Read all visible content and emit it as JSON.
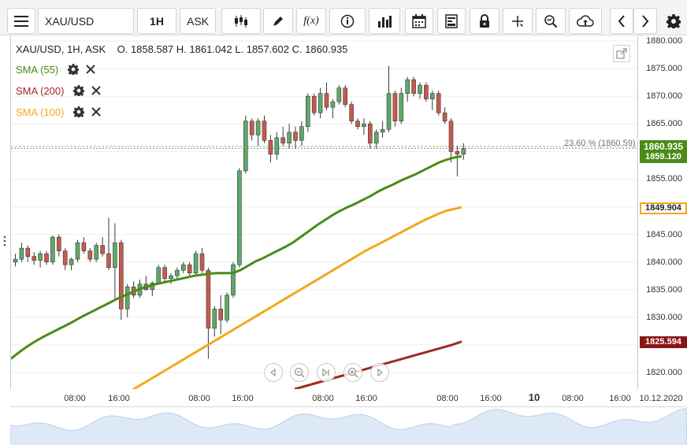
{
  "toolbar": {
    "symbol": "XAU/USD",
    "timeframe": "1H",
    "price_side": "ASK",
    "fx_label": "f(x)"
  },
  "ohlc": {
    "symbol_line": "XAU/USD, 1H, ASK",
    "open": "O. 1858.587",
    "high": "H. 1861.042",
    "low": "L. 1857.602",
    "close": "C. 1860.935"
  },
  "legend": [
    {
      "label": "SMA (55)",
      "color": "#4a8c16"
    },
    {
      "label": "SMA (200)",
      "color": "#a02a24"
    },
    {
      "label": "SMA (100)",
      "color": "#f2a81d"
    }
  ],
  "fib": {
    "label": "23.60 % (1860.59)"
  },
  "price_axis": [
    "1880.000",
    "1875.000",
    "1870.000",
    "1865.000",
    "1860.000",
    "1855.000",
    "1850.000",
    "1845.000",
    "1840.000",
    "1835.000",
    "1830.000",
    "1825.000",
    "1820.000"
  ],
  "time_axis": {
    "labels": [
      "08:00",
      "16:00",
      "08:00",
      "16:00",
      "08:00",
      "16:00",
      "08:00",
      "16:00",
      "10",
      "08:00",
      "16:00",
      "10.12.2020"
    ]
  },
  "price_tags": {
    "last": "1860.935",
    "sma55": "1859.120",
    "sma100": "1849.904",
    "sma200": "1825.594"
  },
  "colors": {
    "up": "#5ea96a",
    "down": "#c65a4d",
    "sma55": "#4a8c16",
    "sma100": "#f2a81d",
    "sma200": "#a02a24",
    "last_tag": "#4a8c16",
    "sma100_tag": "#f2a81d",
    "sma200_tag": "#8b1414"
  },
  "chart_data": {
    "type": "line",
    "y_range": [
      1817,
      1881
    ],
    "ylim": [
      1817,
      1881
    ],
    "x_count": 70,
    "series": [
      {
        "name": "SMA (55)",
        "values": [
          1822.5,
          1823.6,
          1824.6,
          1825.5,
          1826.3,
          1827.0,
          1827.7,
          1828.4,
          1829.1,
          1829.9,
          1830.6,
          1831.3,
          1832.0,
          1832.7,
          1833.4,
          1834.0,
          1834.6,
          1835.2,
          1835.6,
          1836.0,
          1836.3,
          1836.6,
          1836.9,
          1837.2,
          1837.5,
          1837.7,
          1837.9,
          1838.0,
          1838.0,
          1838.0,
          1838.5,
          1839.3,
          1840.1,
          1840.7,
          1841.4,
          1842.1,
          1842.8,
          1843.6,
          1844.6,
          1845.6,
          1846.6,
          1847.5,
          1848.4,
          1849.2,
          1849.9,
          1850.5,
          1851.2,
          1851.9,
          1852.7,
          1853.4,
          1854.0,
          1854.7,
          1855.3,
          1855.9,
          1856.6,
          1857.3,
          1858.0,
          1858.5,
          1858.9,
          1859.12
        ]
      },
      {
        "name": "SMA (100)",
        "values": [
          1814.8,
          1815.6,
          1816.4,
          1817.2,
          1818.0,
          1818.8,
          1819.6,
          1820.4,
          1821.2,
          1822.0,
          1822.8,
          1823.6,
          1824.4,
          1825.2,
          1826.0,
          1826.8,
          1827.6,
          1828.4,
          1829.2,
          1830.0,
          1830.8,
          1831.6,
          1832.4,
          1833.2,
          1834.0,
          1834.8,
          1835.6,
          1836.4,
          1837.2,
          1838.0,
          1838.8,
          1839.6,
          1840.4,
          1841.2,
          1842.0,
          1842.7,
          1843.4,
          1844.1,
          1844.8,
          1845.5,
          1846.2,
          1846.9,
          1847.6,
          1848.2,
          1848.8,
          1849.3,
          1849.6,
          1849.904
        ]
      },
      {
        "name": "SMA (200)",
        "values": [
          1817.0,
          1817.5,
          1818.0,
          1818.5,
          1819.0,
          1819.5,
          1820.0,
          1820.5,
          1821.0,
          1821.5,
          1822.0,
          1822.5,
          1823.0,
          1823.5,
          1824.0,
          1824.5,
          1825.0,
          1825.594
        ]
      }
    ],
    "candles": [
      [
        1840.0,
        1841.5,
        1839.2,
        1840.5
      ],
      [
        1840.5,
        1843.5,
        1840.0,
        1842.5
      ],
      [
        1842.5,
        1843.0,
        1840.0,
        1841.0
      ],
      [
        1841.0,
        1841.8,
        1839.5,
        1840.3
      ],
      [
        1840.3,
        1842.0,
        1839.0,
        1841.5
      ],
      [
        1841.5,
        1842.0,
        1839.5,
        1840.0
      ],
      [
        1840.0,
        1844.8,
        1839.5,
        1844.5
      ],
      [
        1844.5,
        1845.0,
        1841.0,
        1842.0
      ],
      [
        1842.0,
        1842.5,
        1838.5,
        1839.5
      ],
      [
        1839.5,
        1840.8,
        1838.5,
        1840.5
      ],
      [
        1840.5,
        1844.0,
        1840.0,
        1843.5
      ],
      [
        1843.5,
        1844.5,
        1841.5,
        1842.0
      ],
      [
        1842.0,
        1842.5,
        1840.0,
        1840.5
      ],
      [
        1840.5,
        1843.5,
        1840.0,
        1843.0
      ],
      [
        1843.0,
        1844.5,
        1841.0,
        1841.5
      ],
      [
        1841.5,
        1848.0,
        1838.5,
        1839.0
      ],
      [
        1839.0,
        1847.0,
        1833.0,
        1843.5
      ],
      [
        1843.5,
        1844.0,
        1829.5,
        1831.5
      ],
      [
        1831.5,
        1836.0,
        1830.0,
        1835.5
      ],
      [
        1835.5,
        1836.5,
        1833.5,
        1834.0
      ],
      [
        1834.0,
        1836.8,
        1833.5,
        1836.0
      ],
      [
        1836.0,
        1837.5,
        1834.8,
        1835.0
      ],
      [
        1835.0,
        1836.5,
        1833.8,
        1836.2
      ],
      [
        1836.2,
        1839.5,
        1836.0,
        1839.0
      ],
      [
        1839.0,
        1839.5,
        1836.5,
        1837.0
      ],
      [
        1837.0,
        1838.0,
        1836.0,
        1837.5
      ],
      [
        1837.5,
        1839.0,
        1837.0,
        1838.5
      ],
      [
        1838.5,
        1840.0,
        1838.0,
        1839.5
      ],
      [
        1839.5,
        1840.0,
        1837.5,
        1838.0
      ],
      [
        1838.0,
        1842.0,
        1837.5,
        1841.5
      ],
      [
        1841.5,
        1842.5,
        1838.0,
        1838.5
      ],
      [
        1838.5,
        1839.0,
        1822.5,
        1828.0
      ],
      [
        1828.0,
        1832.0,
        1826.5,
        1831.5
      ],
      [
        1831.5,
        1834.0,
        1827.0,
        1829.5
      ],
      [
        1829.5,
        1834.5,
        1829.0,
        1834.0
      ],
      [
        1834.0,
        1840.0,
        1833.5,
        1839.5
      ],
      [
        1839.5,
        1857.0,
        1839.0,
        1856.5
      ],
      [
        1856.5,
        1866.5,
        1856.0,
        1865.5
      ],
      [
        1865.5,
        1866.0,
        1862.0,
        1863.0
      ],
      [
        1863.0,
        1866.0,
        1861.0,
        1865.5
      ],
      [
        1865.5,
        1866.5,
        1861.5,
        1862.0
      ],
      [
        1862.0,
        1863.0,
        1858.0,
        1859.5
      ],
      [
        1859.5,
        1863.5,
        1858.5,
        1862.5
      ],
      [
        1862.5,
        1864.5,
        1861.0,
        1861.5
      ],
      [
        1861.5,
        1865.0,
        1860.5,
        1863.5
      ],
      [
        1863.5,
        1864.5,
        1860.5,
        1862.0
      ],
      [
        1862.0,
        1865.5,
        1861.0,
        1864.5
      ],
      [
        1864.5,
        1870.5,
        1863.5,
        1870.0
      ],
      [
        1870.0,
        1870.5,
        1866.5,
        1867.0
      ],
      [
        1867.0,
        1871.5,
        1866.0,
        1870.5
      ],
      [
        1870.5,
        1872.5,
        1867.5,
        1868.0
      ]
    ]
  }
}
